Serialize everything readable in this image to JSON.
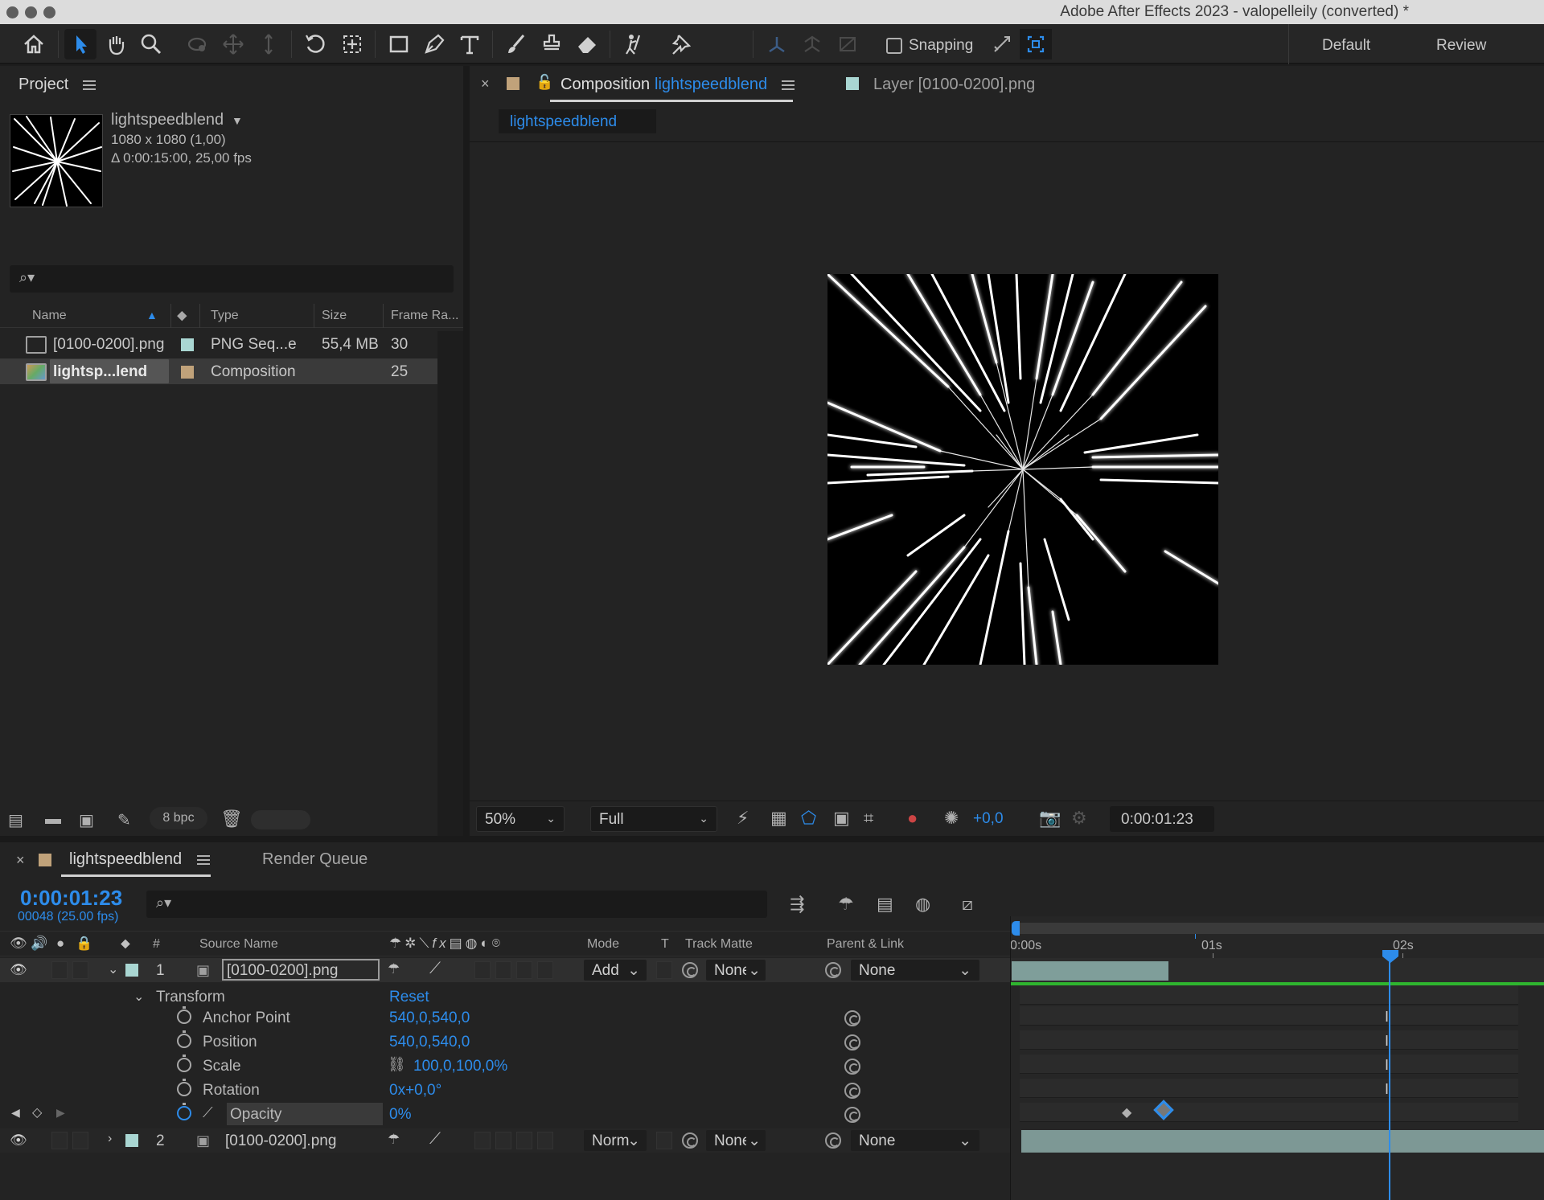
{
  "window": {
    "title": "Adobe After Effects 2023 - valopelleily (converted) *"
  },
  "toolbar": {
    "snapping_label": "Snapping",
    "workspaces": [
      "Default",
      "Review"
    ]
  },
  "project": {
    "tab_label": "Project",
    "selected_item": {
      "name": "lightspeedblend",
      "dimensions": "1080 x 1080 (1,00)",
      "duration": "Δ 0:00:15:00, 25,00 fps"
    },
    "search_placeholder": "",
    "columns": [
      "Name",
      "Type",
      "Size",
      "Frame Ra..."
    ],
    "items": [
      {
        "name": "[0100-0200].png",
        "type": "PNG Seq...e",
        "size": "55,4 MB",
        "fps": "30",
        "color": "#a9d6d2",
        "icon": "footage-icon"
      },
      {
        "name": "lightsp...lend",
        "type": "Composition",
        "size": "",
        "fps": "25",
        "color": "#c0a27a",
        "icon": "composition-icon"
      }
    ],
    "bit_depth": "8 bpc"
  },
  "composition_viewer": {
    "tab_prefix": "Composition",
    "tab_name": "lightspeedblend",
    "layer_tab": "Layer [0100-0200].png",
    "breadcrumb": "lightspeedblend",
    "zoom": "50%",
    "resolution": "Full",
    "exposure": "+0,0",
    "timecode": "0:00:01:23"
  },
  "timeline": {
    "tab_label": "lightspeedblend",
    "render_queue_label": "Render Queue",
    "current_time": "0:00:01:23",
    "frame_info": "00048 (25.00 fps)",
    "headers": {
      "number": "#",
      "source_name": "Source Name",
      "mode": "Mode",
      "t": "T",
      "track_matte": "Track Matte",
      "parent": "Parent & Link"
    },
    "ruler": [
      "0:00s",
      "01s",
      "02s"
    ],
    "layers": [
      {
        "index": "1",
        "name": "[0100-0200].png",
        "mode": "Add",
        "matte": "None",
        "parent": "None"
      },
      {
        "index": "2",
        "name": "[0100-0200].png",
        "mode": "Norm",
        "matte": "None",
        "parent": "None"
      }
    ],
    "transform": {
      "label": "Transform",
      "reset": "Reset",
      "properties": [
        {
          "name": "Anchor Point",
          "value": "540,0,540,0"
        },
        {
          "name": "Position",
          "value": "540,0,540,0"
        },
        {
          "name": "Scale",
          "value": "100,0,100,0%"
        },
        {
          "name": "Rotation",
          "value": "0x+0,0°"
        },
        {
          "name": "Opacity",
          "value": "0%"
        }
      ]
    }
  }
}
